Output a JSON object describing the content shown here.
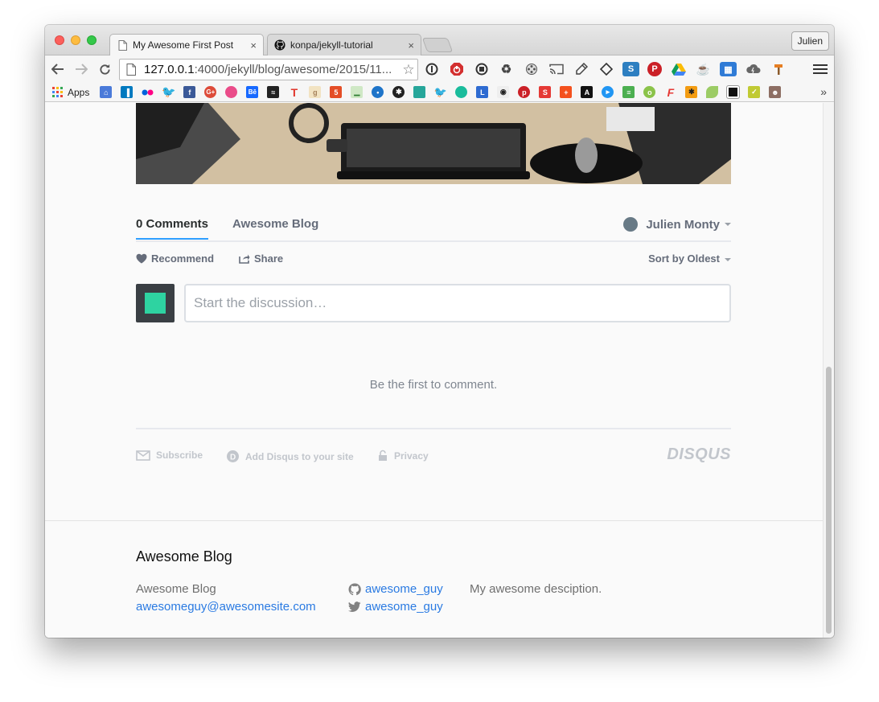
{
  "browser": {
    "tabs": [
      {
        "title": "My Awesome First Post",
        "close": "×",
        "active": true,
        "icon": "page-icon"
      },
      {
        "title": "konpa/jekyll-tutorial",
        "close": "×",
        "active": false,
        "icon": "github-icon"
      }
    ],
    "profile_name": "Julien",
    "address_bar": {
      "host": "127.0.0.1",
      "path": ":4000/jekyll/blog/awesome/2015/11..."
    },
    "bookmarks": {
      "apps_label": "Apps",
      "more": "»"
    },
    "colors": {
      "close": "#fc605c",
      "minimize": "#fdbc40",
      "maximize": "#34c84a"
    }
  },
  "disqus": {
    "tabs": {
      "comments": "0 Comments",
      "community": "Awesome Blog"
    },
    "user": "Julien Monty",
    "actions": {
      "recommend": "Recommend",
      "share": "Share",
      "sort": "Sort by Oldest"
    },
    "composer": {
      "placeholder": "Start the discussion…"
    },
    "empty_message": "Be the first to comment.",
    "footer": {
      "subscribe": "Subscribe",
      "add_disqus": "Add Disqus to your site",
      "privacy": "Privacy",
      "logo": "DISQUS"
    },
    "accent_color": "#2e9fff"
  },
  "site_footer": {
    "title": "Awesome Blog",
    "blog_name": "Awesome Blog",
    "email": "awesomeguy@awesomesite.com",
    "github_user": "awesome_guy",
    "twitter_user": "awesome_guy",
    "description": "My awesome desciption.",
    "link_color": "#2a7ae2"
  }
}
